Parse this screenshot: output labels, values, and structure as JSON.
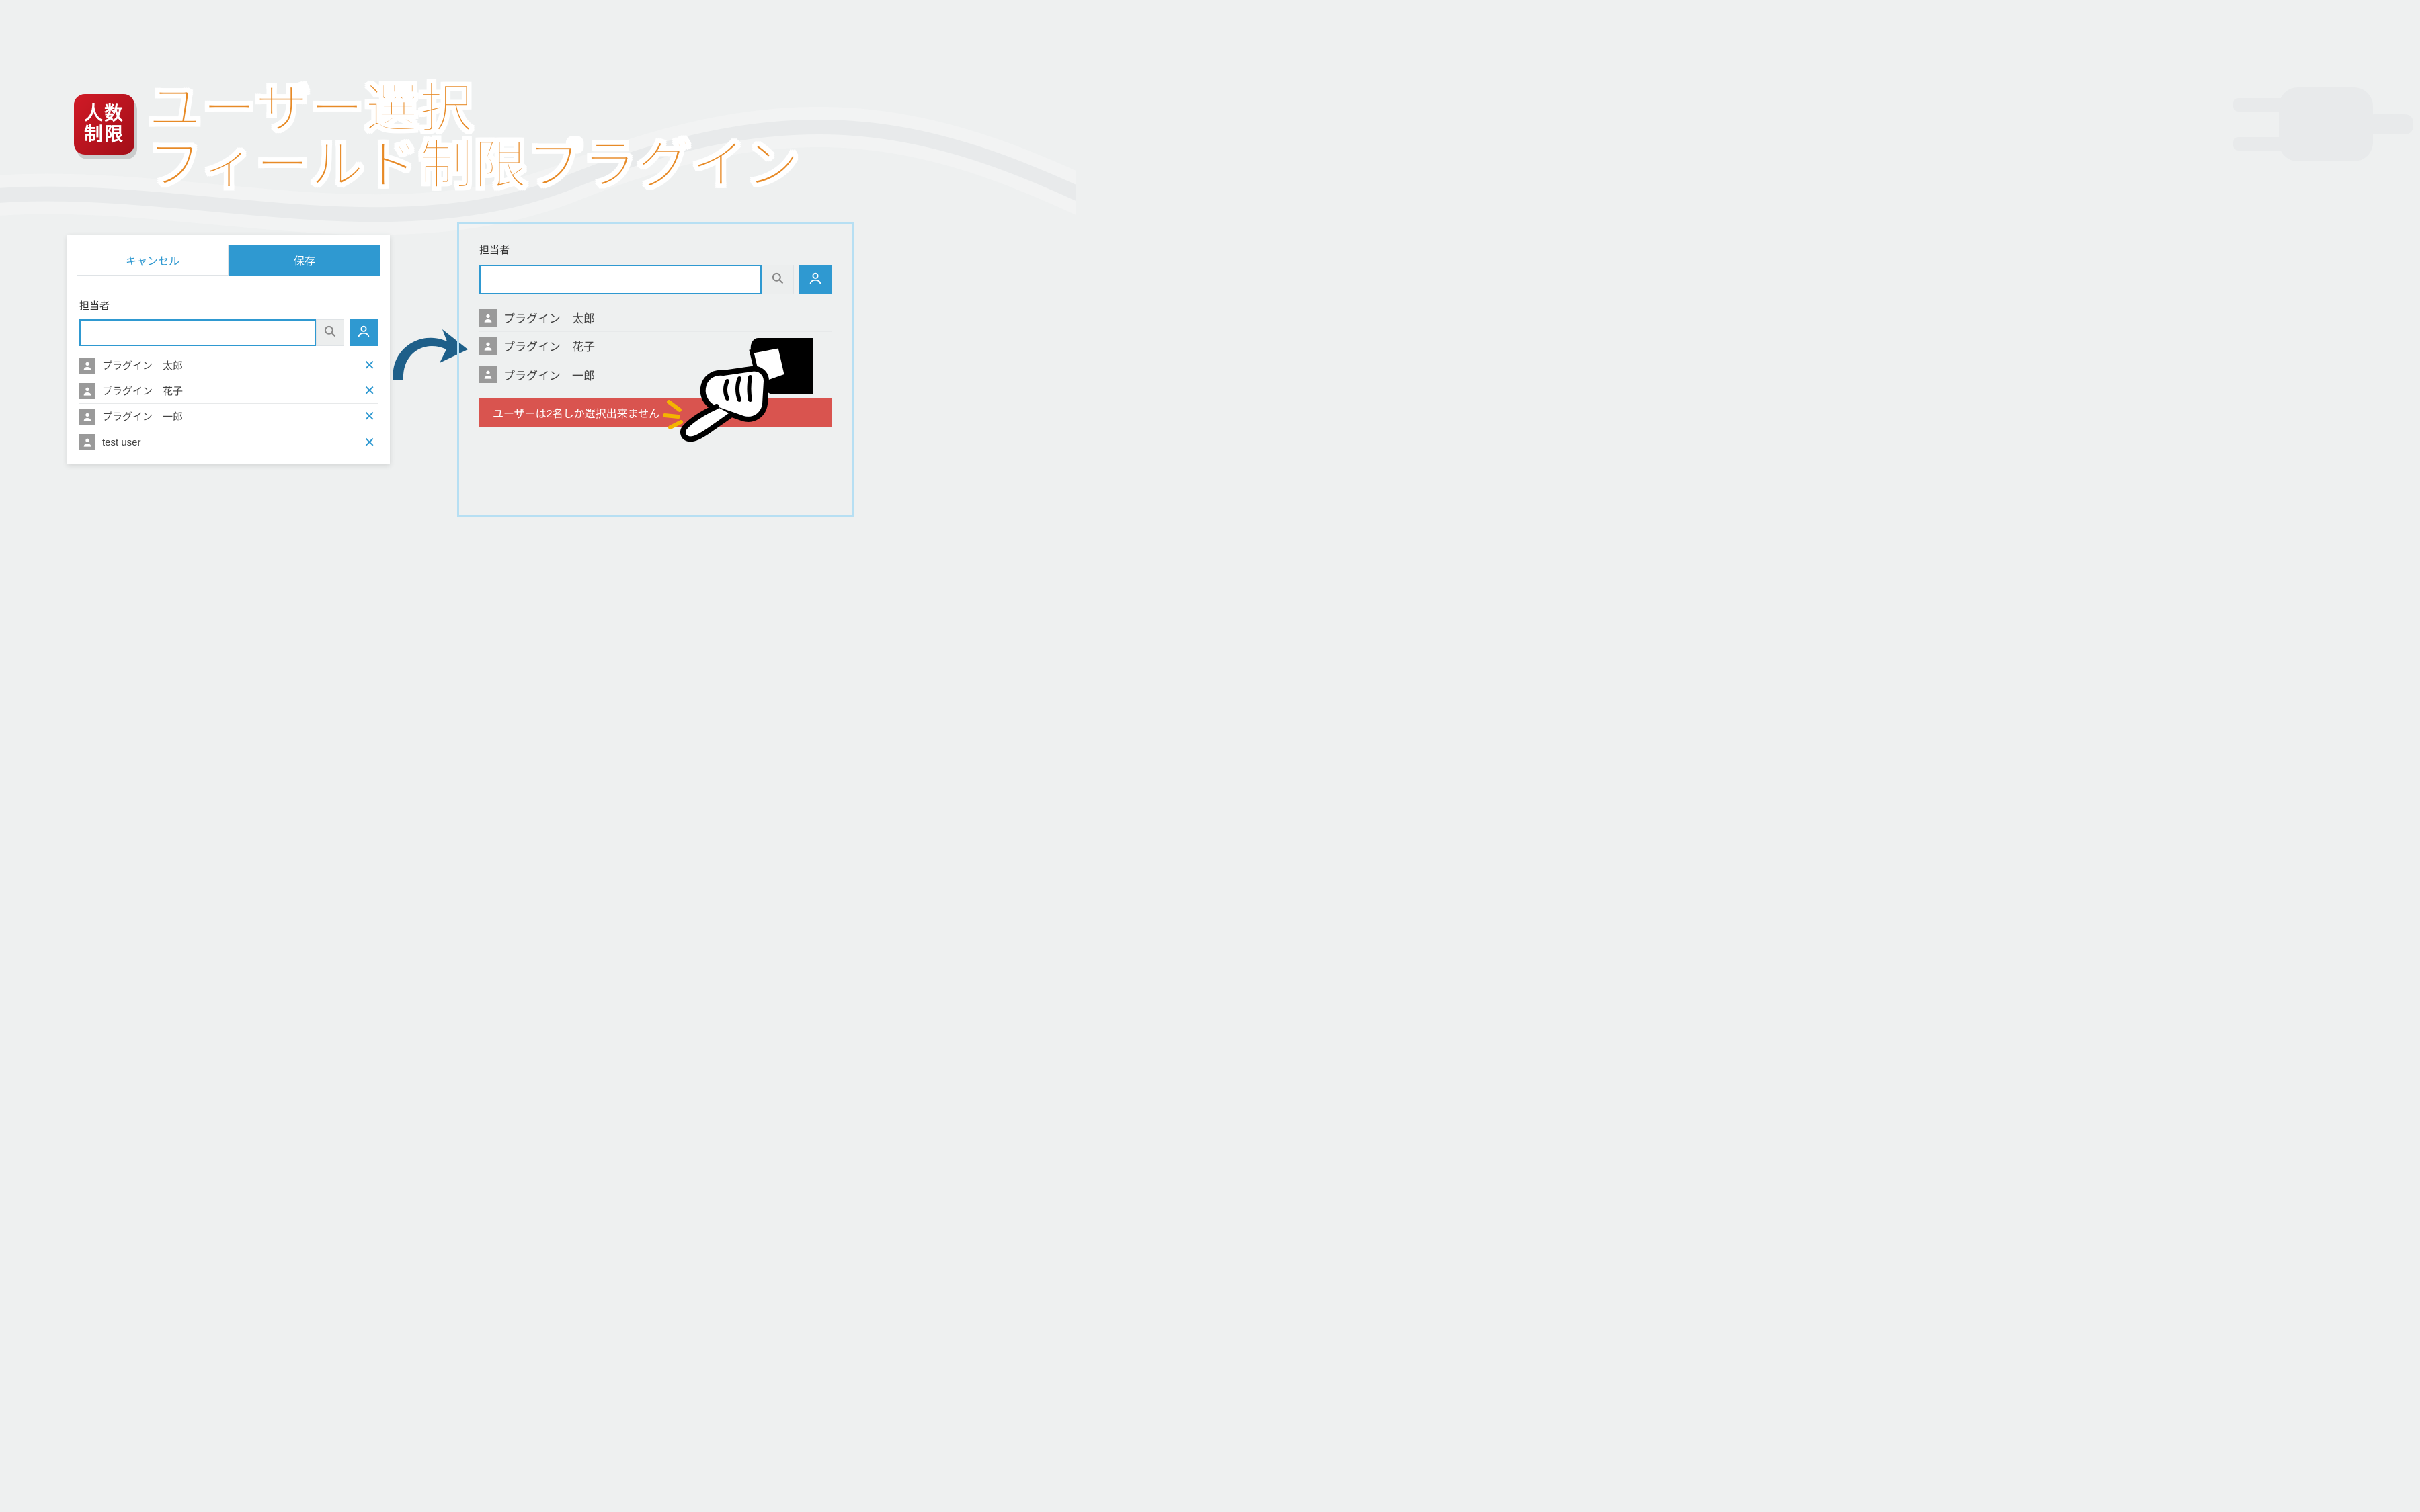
{
  "badge": {
    "line1": "人数",
    "line2": "制限"
  },
  "title": {
    "line1": "ユーザー選択",
    "line2": "フィールド制限プラグイン"
  },
  "left": {
    "cancel": "キャンセル",
    "save": "保存",
    "label": "担当者",
    "search_value": "",
    "users": [
      {
        "name": "プラグイン　太郎"
      },
      {
        "name": "プラグイン　花子"
      },
      {
        "name": "プラグイン　一郎"
      },
      {
        "name": "test user"
      }
    ]
  },
  "right": {
    "label": "担当者",
    "search_value": "",
    "users": [
      {
        "name": "プラグイン　太郎"
      },
      {
        "name": "プラグイン　花子"
      },
      {
        "name": "プラグイン　一郎"
      }
    ],
    "error": "ユーザーは2名しか選択出来ません"
  },
  "icons": {
    "search": "search-icon",
    "user_picker": "user-picker-icon",
    "avatar": "avatar-icon",
    "remove": "✕"
  }
}
